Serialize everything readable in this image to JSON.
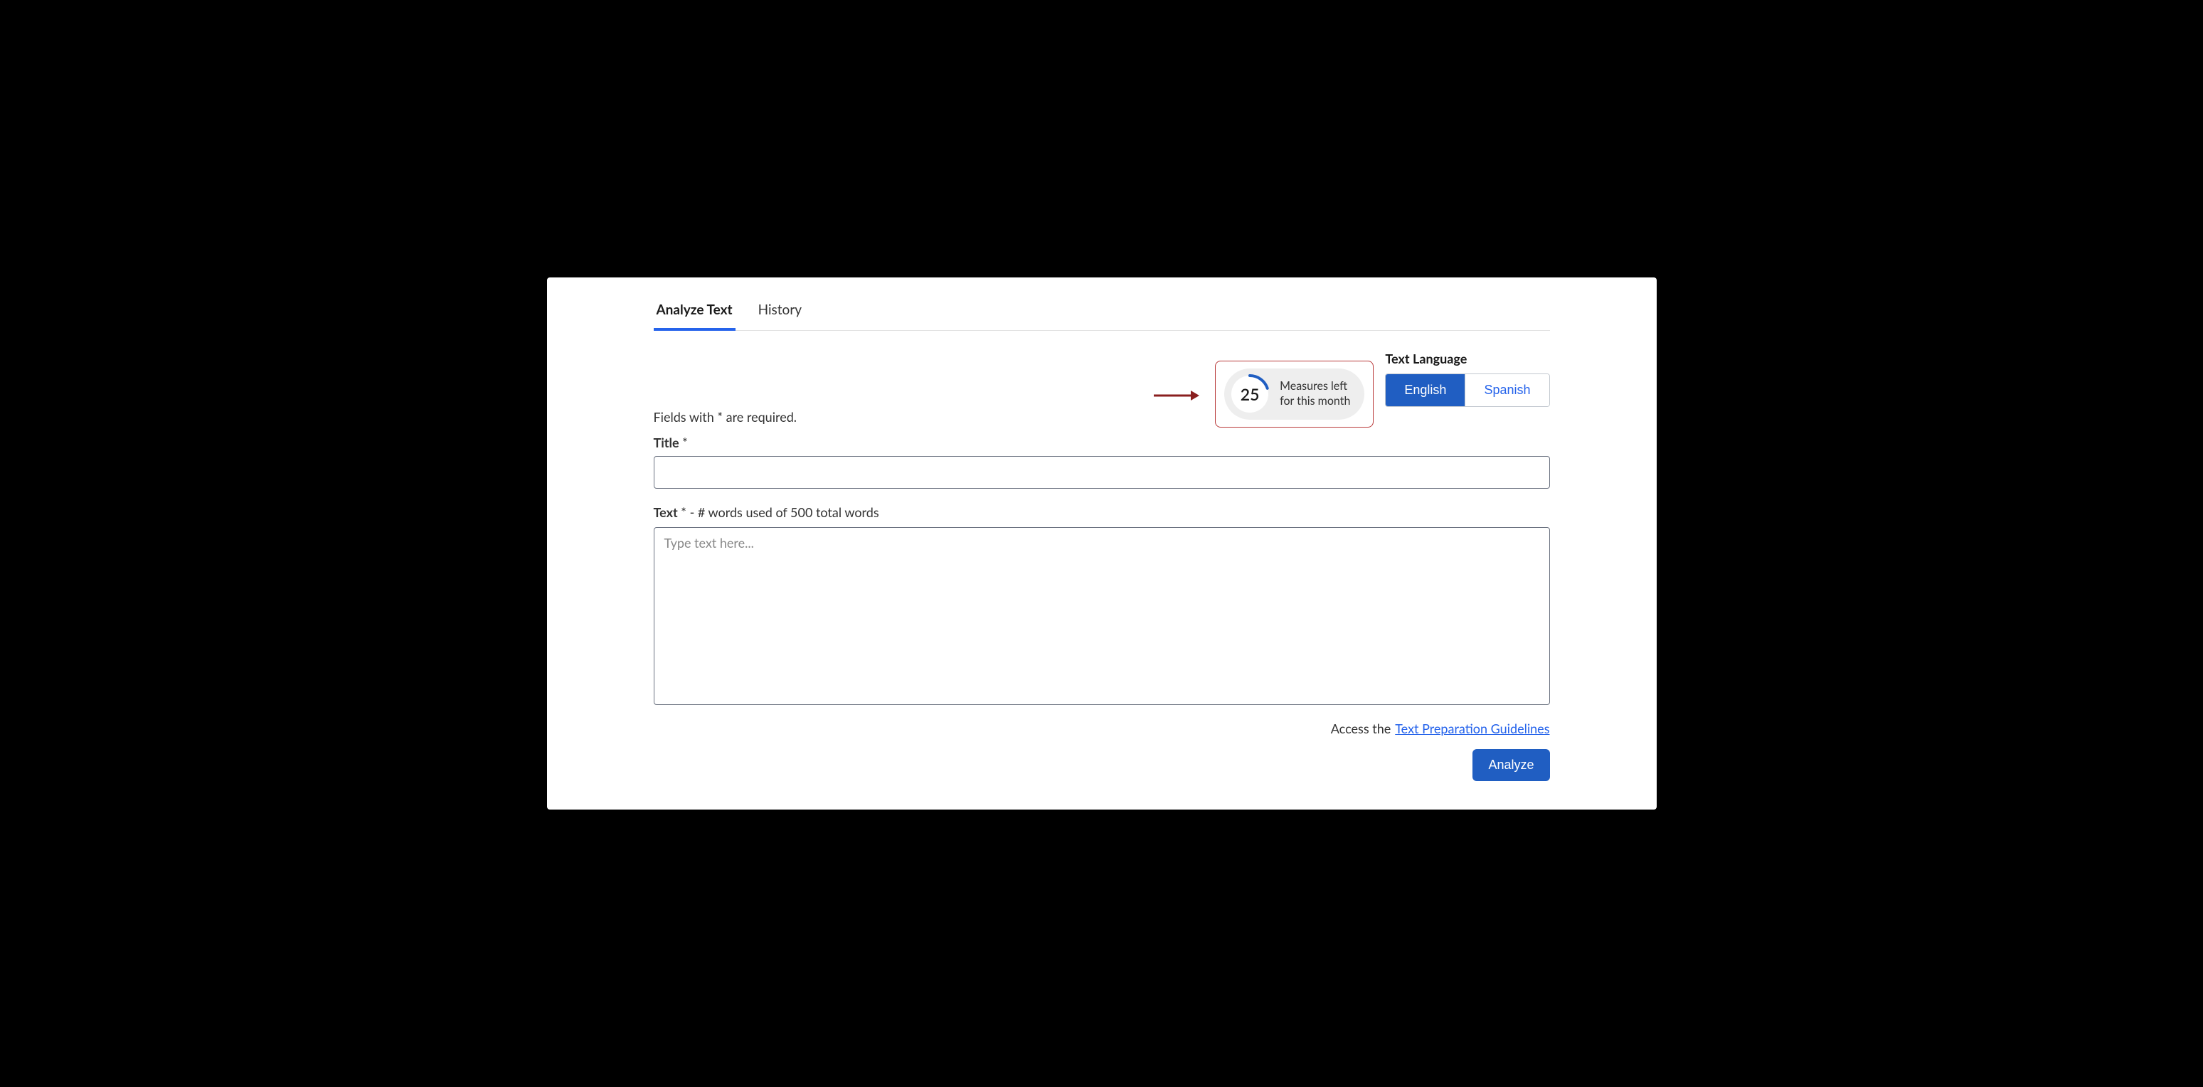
{
  "tabs": {
    "analyze": "Analyze Text",
    "history": "History"
  },
  "requiredNote": "Fields with * are required.",
  "measures": {
    "count": "25",
    "line1": "Measures left",
    "line2": "for this month"
  },
  "language": {
    "label": "Text Language",
    "english": "English",
    "spanish": "Spanish"
  },
  "title": {
    "label": "Title",
    "required": " *",
    "value": ""
  },
  "text": {
    "labelBold": "Text",
    "labelRest": " * -  # words used of 500 total words",
    "placeholder": "Type text here...",
    "value": ""
  },
  "footer": {
    "prefix": "Access the ",
    "linkText": "Text Preparation Guidelines"
  },
  "analyzeBtn": "Analyze",
  "colors": {
    "primary": "#205ec2",
    "highlightBorder": "#b93a3a"
  }
}
